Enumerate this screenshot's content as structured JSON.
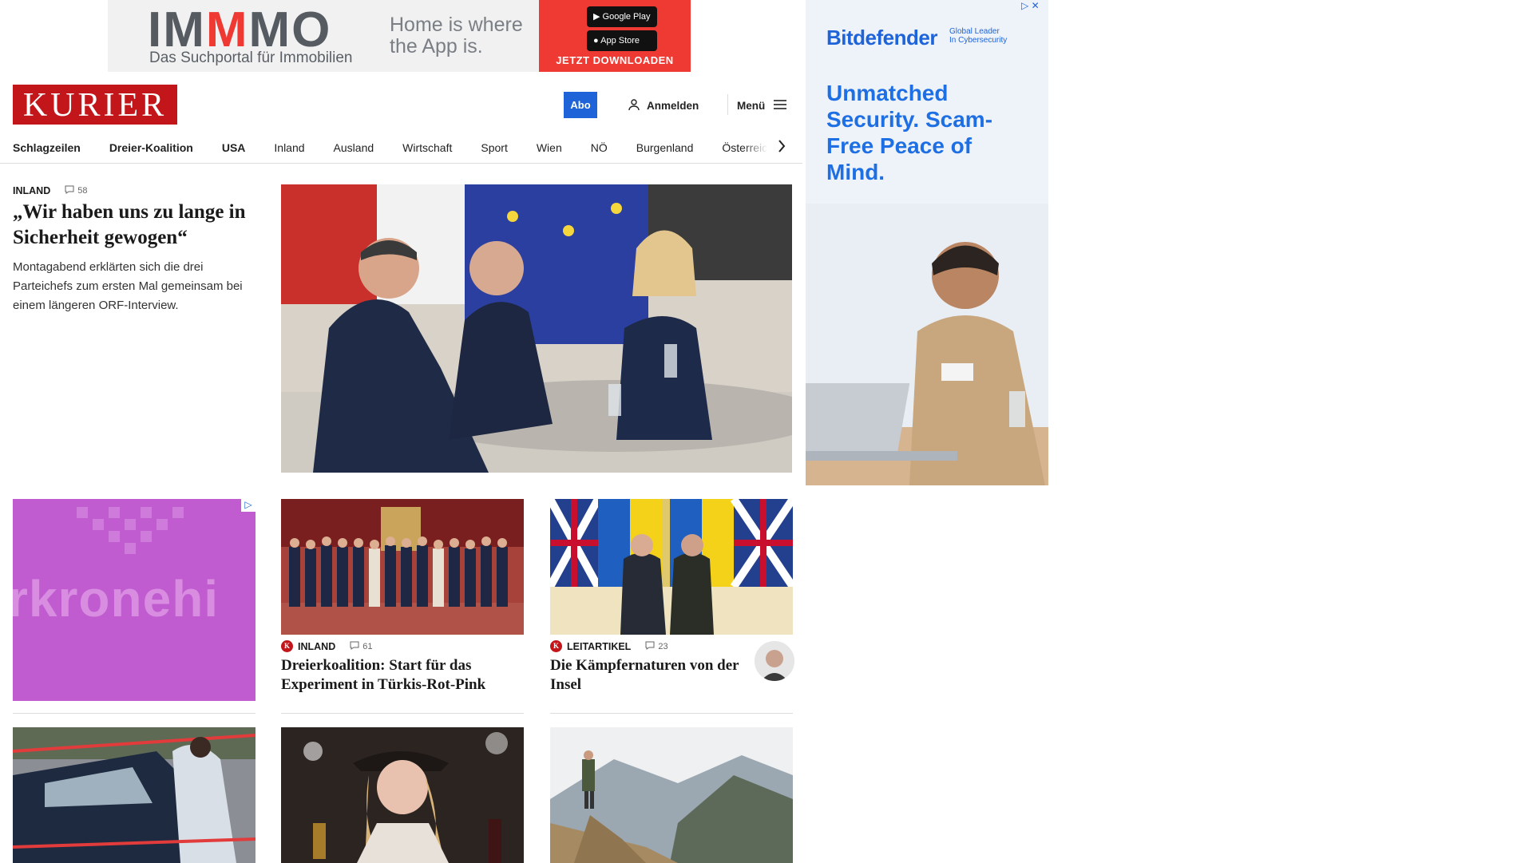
{
  "top_ad": {
    "brand_a": "IM",
    "brand_b": "M",
    "brand_c": "MO",
    "subline": "Das Suchportal für Immobilien",
    "claim_line1": "Home is where",
    "claim_line2": "the App is.",
    "google_play": "Google Play",
    "app_store": "App Store",
    "cta": "JETZT DOWNLOADEN"
  },
  "header": {
    "logo": "KURIER",
    "abo_label": "Abo",
    "login_label": "Anmelden",
    "menu_label": "Menü"
  },
  "nav": {
    "items": [
      {
        "label": "Schlagzeilen",
        "bold": true
      },
      {
        "label": "Dreier-Koalition",
        "bold": true
      },
      {
        "label": "USA",
        "bold": true
      },
      {
        "label": "Inland"
      },
      {
        "label": "Ausland"
      },
      {
        "label": "Wirtschaft"
      },
      {
        "label": "Sport"
      },
      {
        "label": "Wien"
      },
      {
        "label": "NÖ"
      },
      {
        "label": "Burgenland"
      },
      {
        "label": "Österreich"
      }
    ]
  },
  "lead": {
    "section": "INLAND",
    "comments": "58",
    "title": "„Wir haben uns zu lange in Sicherheit gewogen“",
    "teaser": "Montagabend erklärten sich die drei Parteichefs zum ersten Mal gemeinsam bei einem längeren ORF-Interview."
  },
  "sky_ad": {
    "brand": "Bitdefender",
    "tag_line1": "Global Leader",
    "tag_line2": "In Cybersecurity",
    "headline": "Unmatched Security. Scam-Free Peace of Mind."
  },
  "purple_ad": {
    "text": "rkronehi"
  },
  "cards": [
    {
      "section": "INLAND",
      "comments": "61",
      "title": "Dreierkoalition: Start für das Experiment in Türkis-Rot-Pink"
    },
    {
      "section": "LEITARTIKEL",
      "comments": "23",
      "title": "Die Kämpfernaturen von der Insel"
    }
  ],
  "colors": {
    "brand_red": "#c3161b",
    "abo_blue": "#1e63d8",
    "purple_ad": "#c05bd0"
  }
}
